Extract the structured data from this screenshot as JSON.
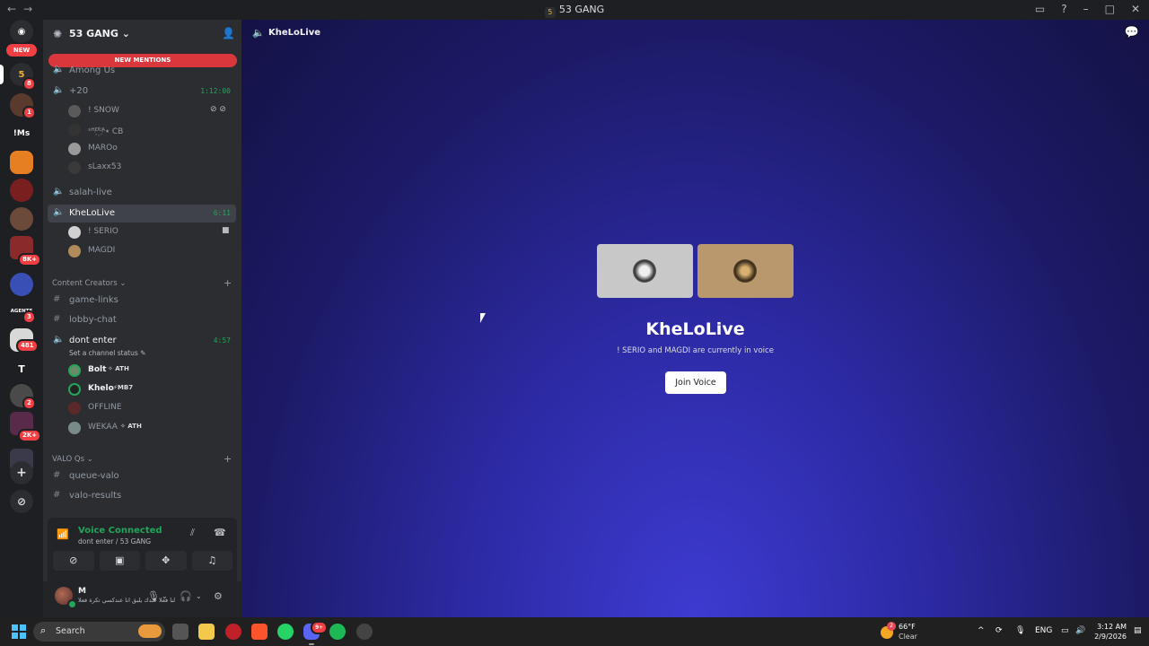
{
  "window": {
    "title": "53 GANG",
    "server_icon_text": "5",
    "nav_back": "←",
    "nav_forward": "→"
  },
  "rail": {
    "new_label": "NEW",
    "servers": [
      {
        "name": "53",
        "badge": "8",
        "color": "#2b2d31"
      },
      {
        "name": "",
        "badge": "1",
        "color": "#5b3a2e"
      },
      {
        "name": "!Ms",
        "badge": "",
        "color": "#1e1f22"
      },
      {
        "name": "",
        "badge": "",
        "color": "#e67e22"
      },
      {
        "name": "",
        "badge": "",
        "color": "#7a1f1f"
      },
      {
        "name": "",
        "badge": "",
        "color": "#6b4a3a"
      },
      {
        "name": "",
        "badge": "8K+",
        "color": "#8b2a2a"
      },
      {
        "name": "",
        "badge": "",
        "color": "#3a4fb5"
      },
      {
        "name": "AGENTS",
        "badge": "3",
        "color": "#1e1f22"
      },
      {
        "name": "",
        "badge": "481",
        "color": "#d8d8d8"
      },
      {
        "name": "T",
        "badge": "",
        "color": "#1e1f22"
      },
      {
        "name": "",
        "badge": "2",
        "color": "#4a4a4a"
      },
      {
        "name": "",
        "badge": "2K+",
        "color": "#5a2a4a"
      },
      {
        "name": "",
        "badge": "",
        "color": "#3a3a4a"
      }
    ],
    "add_icon": "+",
    "discover_icon": "⊘"
  },
  "server": {
    "name": "53 GANG",
    "new_mentions": "NEW MENTIONS"
  },
  "channels": {
    "among_us": "Among Us",
    "plus20": "+20",
    "plus20_timer": "1:12:00",
    "plus20_users": [
      "! SNOW",
      "ˢᴴᴼ꙰ᴸᴬ٭ CB",
      "MAROo",
      "sLaxx53"
    ],
    "salah_live": "salah-live",
    "khelolive": "KheLoLive",
    "khelolive_timer": "6:11",
    "khelolive_users": [
      "! SERIO",
      "MAGDI"
    ],
    "category_content": "Content Creators",
    "game_links": "game-links",
    "lobby_chat": "lobby-chat",
    "dont_enter": "dont enter",
    "dont_enter_timer": "4:57",
    "channel_status": "Set a channel status",
    "dont_enter_users": [
      {
        "name": "Bolt",
        "tag": "✧ ATH"
      },
      {
        "name": "Khelo",
        "tag": "⚡MB7"
      },
      {
        "name": "OFFLINE",
        "tag": ""
      },
      {
        "name": "WEKAA",
        "tag": "✧ ATH"
      }
    ],
    "category_valo": "VALO Qs",
    "queue_valo": "queue-valo",
    "valo_results": "valo-results"
  },
  "voice_panel": {
    "title": "Voice Connected",
    "subtitle": "dont enter / 53 GANG"
  },
  "user_panel": {
    "name": "M",
    "status": "يبقى لنا فعلا عندك يلبق انا عندكسي تكرة فعلا"
  },
  "main": {
    "header_title": "KheLoLive",
    "title": "KheLoLive",
    "subtitle": "! SERIO and MAGDI are currently in voice",
    "join_label": "Join Voice"
  },
  "taskbar": {
    "search_label": "Search",
    "weather_temp": "66°F",
    "weather_desc": "Clear",
    "weather_badge": "2",
    "lang": "ENG",
    "time": "3:12 AM",
    "date": "2/9/2026",
    "discord_badge": "9+"
  },
  "colors": {
    "accent_green": "#23a55a",
    "mention_red": "#da373c",
    "sidebar_bg": "#2b2d31"
  }
}
